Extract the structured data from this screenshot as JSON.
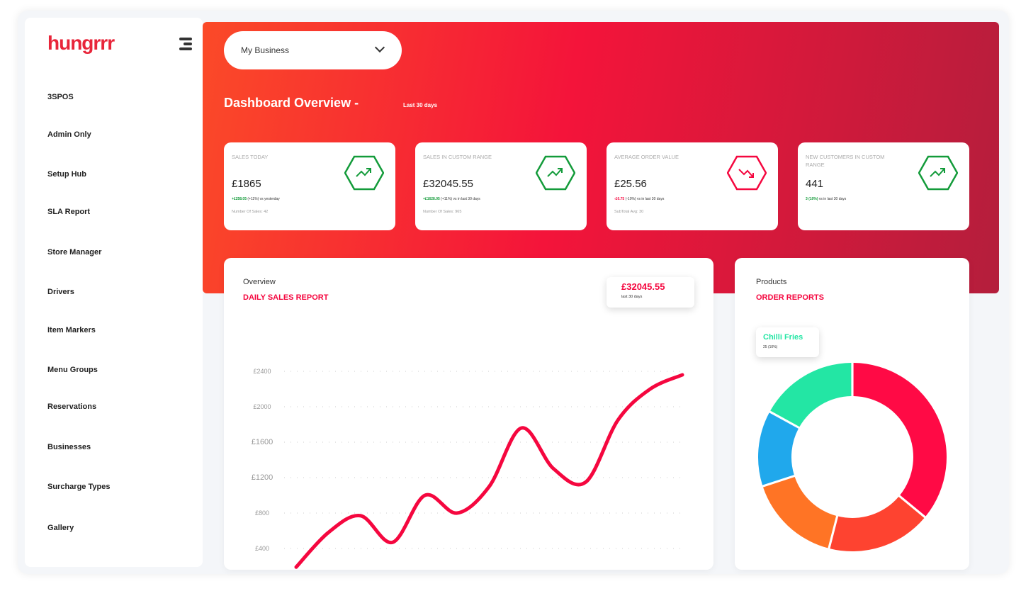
{
  "brand": {
    "logo": "hungrrr",
    "color": "#e8253a"
  },
  "sidebar": {
    "items": [
      {
        "label": "3SPOS"
      },
      {
        "label": "Admin Only"
      },
      {
        "label": "Setup Hub"
      },
      {
        "label": "SLA Report"
      },
      {
        "label": "Store Manager"
      },
      {
        "label": "Drivers"
      },
      {
        "label": "Item Markers"
      },
      {
        "label": "Menu Groups"
      },
      {
        "label": "Reservations"
      },
      {
        "label": "Businesses"
      },
      {
        "label": "Surcharge Types"
      },
      {
        "label": "Gallery"
      }
    ]
  },
  "business_select": {
    "value": "My Business"
  },
  "header": {
    "title": "Dashboard Overview -",
    "range": "Last 30 days"
  },
  "cards": [
    {
      "label": "Sales Today",
      "value": "£1865",
      "change": "+£258.05",
      "change_note": "(+11%) vs yesterday",
      "sub": "Number Of Sales: 42",
      "trend": "up"
    },
    {
      "label": "Sales in Custom Range",
      "value": "£32045.55",
      "change": "+£1628.05",
      "change_note": "(+11%) vs in last 30 days",
      "sub": "Number Of Sales: 965",
      "trend": "up"
    },
    {
      "label": "Average Order Value",
      "value": "£25.56",
      "change": "-£0.75",
      "change_note": "(-10%) vs in last 30 days",
      "sub": "SubTotal Avg: 30",
      "trend": "down"
    },
    {
      "label": "New Customers in Custom Range",
      "value": "441",
      "change": "3 (10%)",
      "change_note": "vs in last 30 days",
      "sub": "",
      "trend": "up"
    }
  ],
  "colors": {
    "up": "#139b3a",
    "down": "#f5073f",
    "accent": "#f5073f"
  },
  "sales_panel": {
    "eyebrow": "Overview",
    "title": "DAILY SALES REPORT",
    "total": "£32045.55",
    "total_note": "last 30 days"
  },
  "orders_panel": {
    "eyebrow": "Products",
    "title": "ORDER REPORTS",
    "tooltip_name": "Chilli Fries",
    "tooltip_value": "25 (10%)"
  },
  "chart_data": [
    {
      "type": "line",
      "title": "DAILY SALES REPORT",
      "yticks": [
        "£400",
        "£800",
        "£1200",
        "£1600",
        "£2000",
        "£2400"
      ],
      "ylim": [
        0,
        2400
      ],
      "grid": true,
      "values": [
        190,
        580,
        770,
        470,
        1000,
        800,
        1100,
        1760,
        1300,
        1150,
        1850,
        2200,
        2360
      ],
      "color": "#f5073f"
    },
    {
      "type": "pie",
      "donut": true,
      "values": [
        36,
        18,
        16,
        13,
        17
      ],
      "labels": [
        "",
        "",
        "",
        "",
        "Chilli Fries"
      ],
      "colors": [
        "#ff0a45",
        "#fe4330",
        "#ff7425",
        "#20a8ec",
        "#23e6a4"
      ]
    }
  ]
}
